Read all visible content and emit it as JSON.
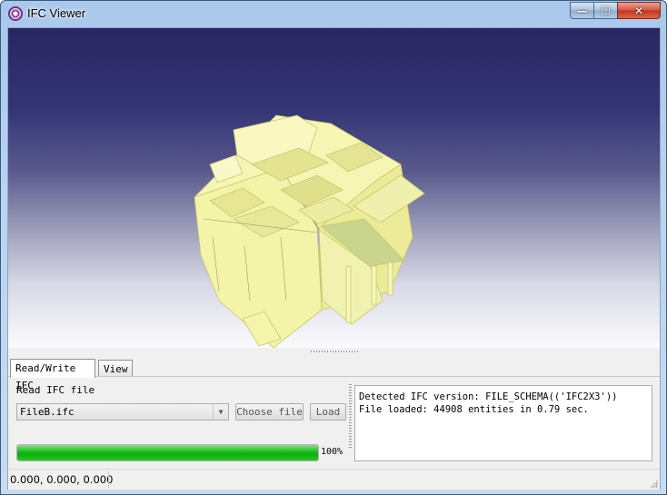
{
  "window": {
    "title": "IFC Viewer",
    "icon": "ifc-app-icon",
    "controls": {
      "minimize": "—",
      "maximize": "☐",
      "close": "✕"
    }
  },
  "viewport": {
    "content": "3d-building-model",
    "model_color": "#f3f3a4",
    "background_top": "#2a2663",
    "background_bottom": "#fbfbfd"
  },
  "tabs": [
    {
      "label": "Read/Write IFC",
      "active": true
    },
    {
      "label": "View",
      "active": false
    }
  ],
  "read_panel": {
    "section_label": "Read IFC file",
    "file_combo_value": "FileB.ifc",
    "choose_button": "Choose file",
    "load_button": "Load",
    "progress_percent": 100,
    "progress_label": "100%",
    "log_lines": [
      "Detected IFC version: FILE_SCHEMA(('IFC2X3'))",
      "File loaded: 44908 entities in 0.79 sec."
    ]
  },
  "statusbar": {
    "coordinates": "0.000, 0.000, 0.000"
  },
  "colors": {
    "progress": "#06b006",
    "close_button": "#c2341c"
  }
}
